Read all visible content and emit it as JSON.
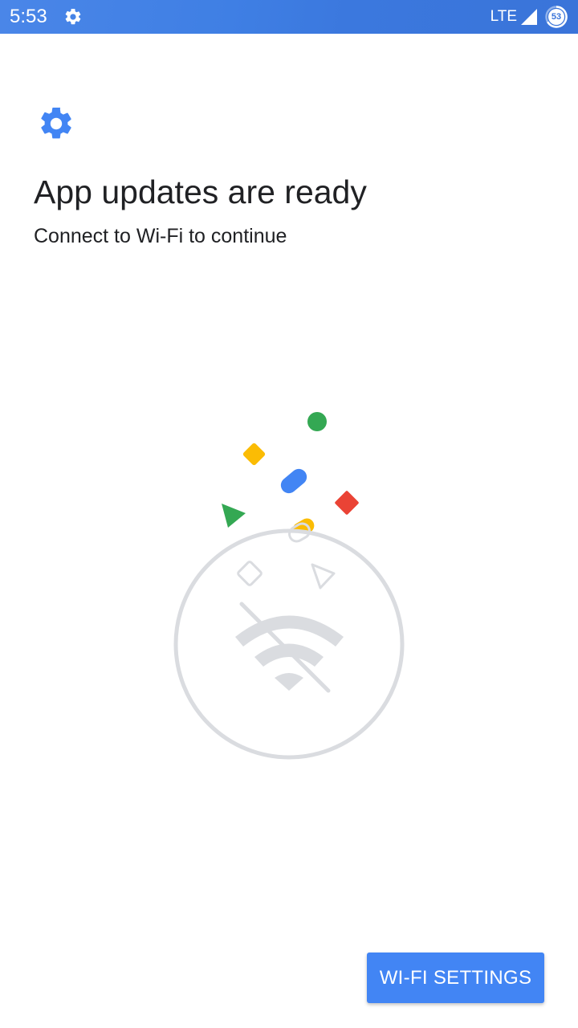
{
  "status_bar": {
    "time": "5:53",
    "network": "LTE",
    "battery_level": "53",
    "icons": [
      "settings-gear-icon",
      "signal-icon",
      "battery-icon"
    ]
  },
  "header": {
    "icon": "settings-gear-icon",
    "title": "App updates are ready",
    "subtitle": "Connect to Wi-Fi to continue"
  },
  "illustration": {
    "icon": "wifi-off-icon",
    "shape_colors": {
      "green": "#34a853",
      "yellow": "#fbbc04",
      "blue": "#4285f4",
      "red": "#ea4335",
      "outline": "#dadce0"
    }
  },
  "actions": {
    "wifi_settings_label": "WI-FI SETTINGS"
  },
  "colors": {
    "accent": "#4285f4",
    "status_bar": "#3f7fe4",
    "text_primary": "#202124"
  }
}
